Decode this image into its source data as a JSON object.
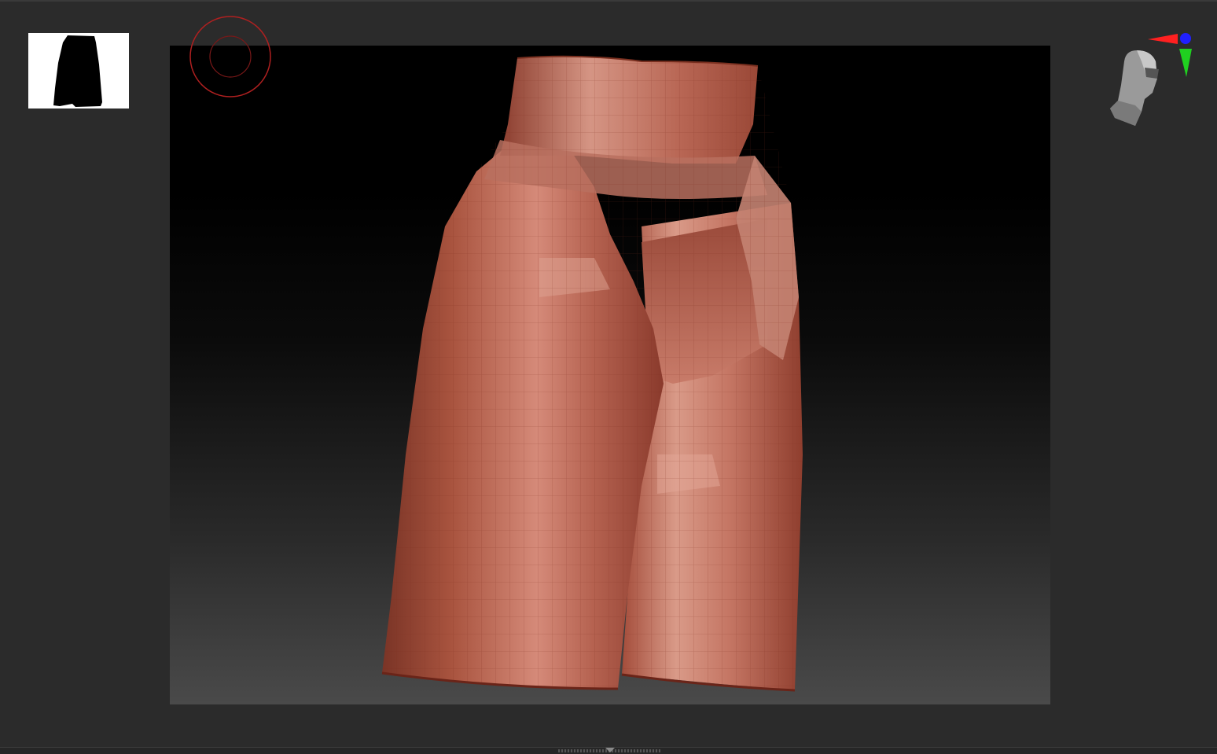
{
  "app": {
    "name": ""
  },
  "thumbnail": {
    "icon": "shorts-silhouette-icon",
    "background": "#ffffff",
    "silhouette": "#000000"
  },
  "viewport": {
    "model": "high-waisted-shorts-mesh",
    "material_color": "#b05a4a",
    "wire_color": "#8a2a1a",
    "background_top": "#000000",
    "background_bottom": "#4a4a4a"
  },
  "brush_cursor": {
    "icon": "brush-circle-icon",
    "color": "#b02020"
  },
  "navigator": {
    "icon": "head-orientation-icon",
    "axis_x_color": "#ff2020",
    "axis_y_color": "#20d020",
    "axis_z_color": "#2020ff"
  }
}
